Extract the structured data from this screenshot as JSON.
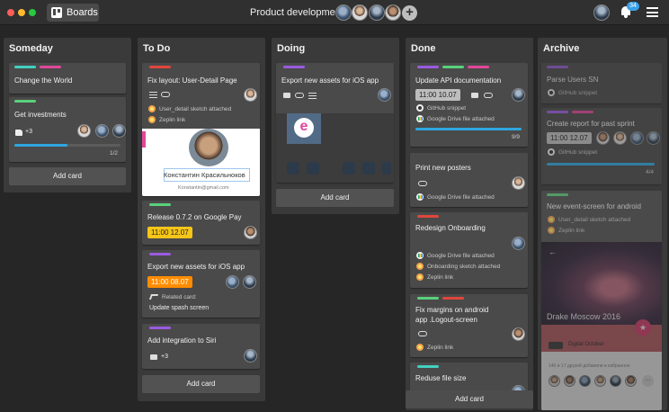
{
  "window": {
    "traffic_lights": [
      "#fd5e57",
      "#fdbb2e",
      "#28c940"
    ]
  },
  "topbar": {
    "boards_label": "Boards",
    "board_title": "Product development",
    "notifications_count": "34"
  },
  "lists": {
    "someday": {
      "title": "Someday",
      "cards": [
        {
          "title": "Change the World"
        },
        {
          "title": "Get investments",
          "likes": "+3",
          "progress": 0.5,
          "progress_text": "1/2"
        }
      ],
      "add_label": "Add card"
    },
    "todo": {
      "title": "To Do",
      "cards": [
        {
          "title": "Fix layout: User-Detail Page",
          "attachments": [
            "User_detail sketch attached",
            "Zeplin link"
          ],
          "cover_name": "Константин Красильноков",
          "cover_email": "Konstantin@gmail.com"
        },
        {
          "title": "Release 0.7.2 on Google Pay",
          "due": "11:00  12.07"
        },
        {
          "title": "Export new assets for iOS app",
          "due": "11:00  08.07",
          "related_label": "Related card:",
          "related_title": "Update spash screen"
        },
        {
          "title": "Add integration to Siri",
          "comments": "+3"
        }
      ],
      "add_label": "Add card"
    },
    "doing": {
      "title": "Doing",
      "cards": [
        {
          "title": "Export new assets for iOS app"
        }
      ],
      "add_label": "Add card"
    },
    "done": {
      "title": "Done",
      "cards": [
        {
          "title": "Update API documentation",
          "due": "11:00  10.07",
          "attachments": [
            "GitHub snippet",
            "Google Drive file attached"
          ],
          "progress": 1.0,
          "progress_text": "9/9"
        },
        {
          "title": "Print new posters",
          "attachments": [
            "Google Drive file attached"
          ]
        },
        {
          "title": "Redesign Onboarding",
          "attachments": [
            "Google Drive file attached",
            "Onboarding sketch attached",
            "Zeplin link"
          ]
        },
        {
          "title": "Fix margins on android app .Logout-screen",
          "attachments": [
            "Zeplin link"
          ]
        },
        {
          "title": "Reduse file size"
        }
      ],
      "add_label": "Add card"
    },
    "archive": {
      "title": "Archive",
      "cards": [
        {
          "title": "Parse Users SN",
          "attachments": [
            "GitHub snippet"
          ]
        },
        {
          "title": "Create report for past sprint",
          "due": "11:00  12.07",
          "attachments": [
            "GitHub snippet"
          ],
          "progress": 1.0,
          "progress_text": "4/4"
        },
        {
          "title": "New event-screen for android",
          "attachments": [
            "User_detail sketch attached",
            "Zeplin link"
          ],
          "cover_title": "Drake Moscow 2016",
          "cover_org": "Digital October",
          "cover_caption": "140 и 17 друзей добавили в избранное"
        }
      ]
    }
  },
  "colors": {
    "label_green": "#5ad07a",
    "label_pink": "#e0479b",
    "label_purple": "#9a5be0",
    "label_red": "#e0463c",
    "label_teal": "#43d0c0",
    "label_blue": "#3a9ee0",
    "due_yellow": "#f5c518",
    "due_orange": "#ff8c00",
    "due_gray": "#bdbdbd",
    "progress": "#2fa6df"
  }
}
